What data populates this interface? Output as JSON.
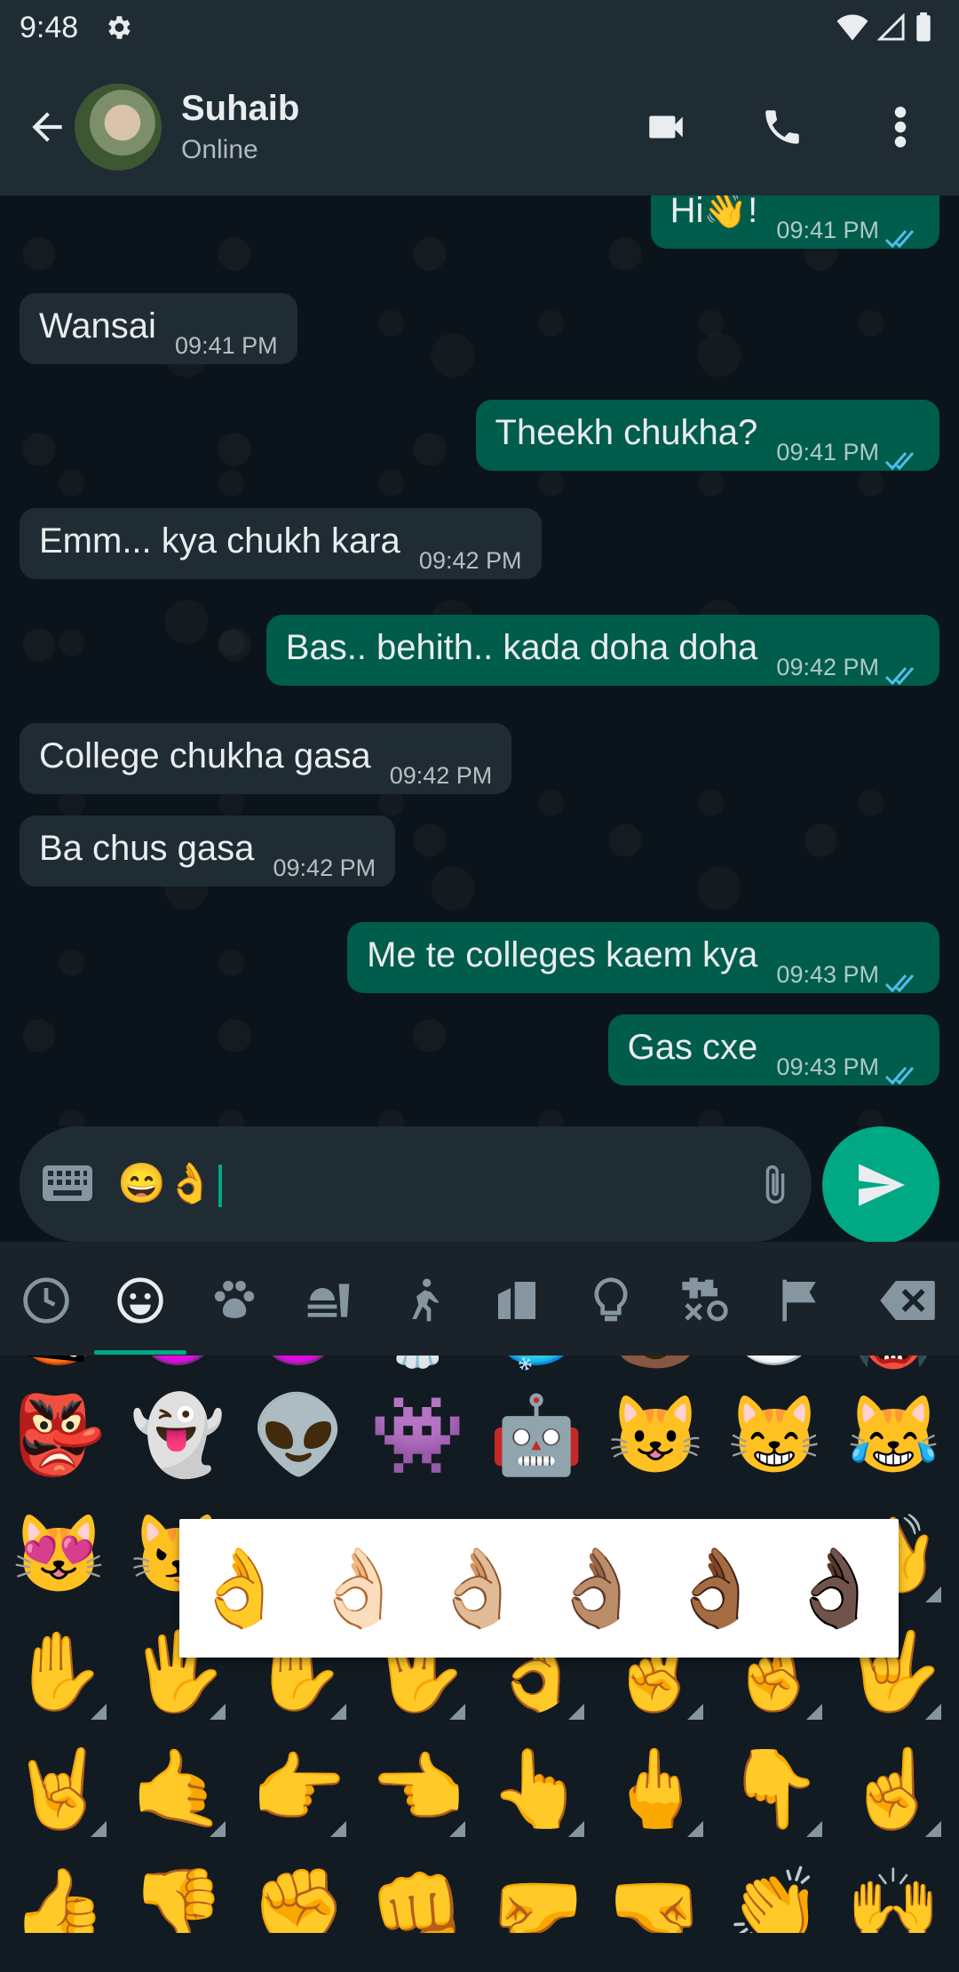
{
  "status_bar": {
    "time": "9:48"
  },
  "header": {
    "contact_name": "Suhaib",
    "presence": "Online"
  },
  "messages": [
    {
      "dir": "out",
      "text": "Hi👋!",
      "time": "09:41 PM"
    },
    {
      "dir": "in",
      "text": "Wansai",
      "time": "09:41 PM"
    },
    {
      "dir": "out",
      "text": "Theekh chukha?",
      "time": "09:41 PM"
    },
    {
      "dir": "in",
      "text": "Emm... kya chukh kara",
      "time": "09:42 PM"
    },
    {
      "dir": "out",
      "text": "Bas.. behith.. kada doha doha",
      "time": "09:42 PM"
    },
    {
      "dir": "in",
      "text": "College chukha gasa",
      "time": "09:42 PM"
    },
    {
      "dir": "in",
      "text": "Ba chus gasa",
      "time": "09:42 PM"
    },
    {
      "dir": "out",
      "text": "Me te colleges kaem kya",
      "time": "09:43 PM"
    },
    {
      "dir": "out",
      "text": "Gas cxe",
      "time": "09:43 PM"
    }
  ],
  "composer": {
    "value": "😄👌"
  },
  "emoji_categories": [
    "recent",
    "smileys",
    "animals",
    "food",
    "activity",
    "travel",
    "objects",
    "symbols",
    "flags"
  ],
  "emoji_rows": [
    [
      "👺",
      "👻",
      "👽",
      "👾",
      "🤖",
      "😺",
      "😸",
      "😹"
    ],
    [
      "😻",
      "😼",
      "",
      "",
      "",
      "",
      "",
      "👋"
    ],
    [
      "✋",
      "🖐",
      "✋",
      "🖖",
      "👌",
      "✌️",
      "🤞",
      "🤟"
    ],
    [
      "🤘",
      "🤙",
      "👉",
      "👈",
      "👆",
      "🖕",
      "👇",
      "☝️"
    ]
  ],
  "skin_tone_popup": [
    "👌",
    "👌🏻",
    "👌🏼",
    "👌🏽",
    "👌🏾",
    "👌🏿"
  ],
  "colors": {
    "incoming": "#202c33",
    "outgoing": "#005c4b",
    "accent": "#00a884",
    "bar": "#1f2c34"
  }
}
